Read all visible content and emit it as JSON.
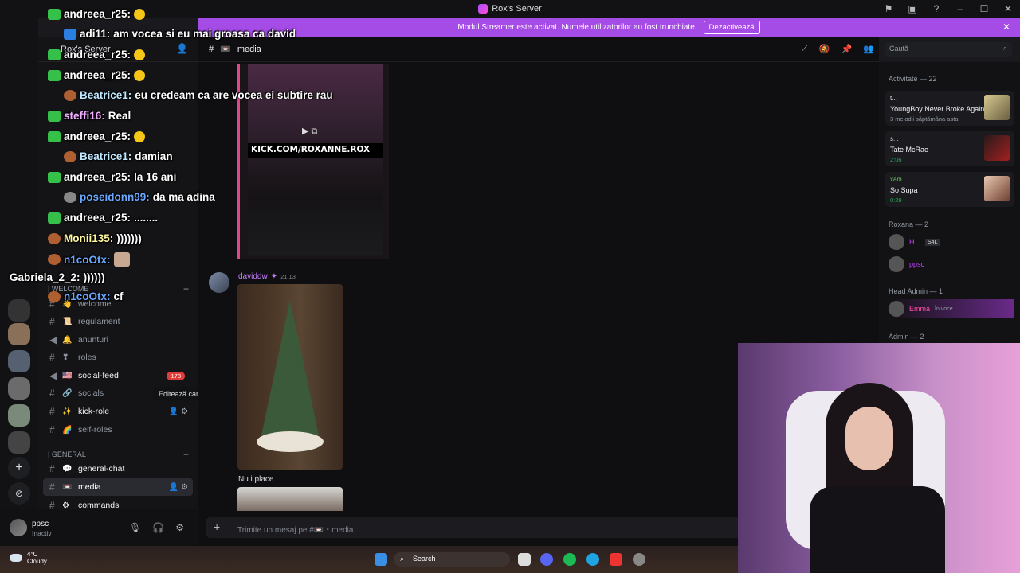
{
  "titlebar": {
    "title": "Rox's Server"
  },
  "banner": {
    "text": "Modul Streamer este activat. Numele utilizatorilor au fost trunchiate.",
    "button": "Dezactivează"
  },
  "server_header": {
    "name": "Rox's Server"
  },
  "channels": {
    "welcome_category": "| WELCOME",
    "general_category": "| GENERAL",
    "items": [
      {
        "label": "welcome",
        "emoji": "👋"
      },
      {
        "label": "regulament",
        "emoji": "📜"
      },
      {
        "label": "anunturi",
        "emoji": "🔔"
      },
      {
        "label": "roles",
        "emoji": "❣"
      },
      {
        "label": "social-feed",
        "emoji": "🇺🇸",
        "badge": "178"
      },
      {
        "label": "socials",
        "emoji": "🔗"
      },
      {
        "label": "kick-role",
        "emoji": "✨"
      },
      {
        "label": "self-roles",
        "emoji": "🌈"
      },
      {
        "label": "general-chat",
        "emoji": "💬"
      },
      {
        "label": "media",
        "emoji": "📼"
      },
      {
        "label": "commands",
        "emoji": "⚙"
      }
    ]
  },
  "tooltip": "Editează canalul",
  "user": {
    "name": "ppsc",
    "status": "Inactiv"
  },
  "main": {
    "channel": "media",
    "search_placeholder": "Caută",
    "kick_text": "KICK.COM/ROXANNE.ROX",
    "author": "daviddw",
    "time": "21:13",
    "message": "Nu i place",
    "composer_placeholder": "Trimite un mesaj pe #📼・media"
  },
  "members": {
    "activity_header": "Activitate — 22",
    "cards": [
      {
        "name": "t...",
        "title": "YoungBoy Never Broke Again",
        "sub": "3 melodii săptămâna asta"
      },
      {
        "name": "s...",
        "title": "Tate McRae",
        "sub": "2:06"
      },
      {
        "name": "xadi",
        "title": "So Supa",
        "sub": "0:29"
      }
    ],
    "roxana_header": "Roxana — 2",
    "head_admin_header": "Head Admin — 1",
    "admin_header": "Admin — 2",
    "rows": [
      {
        "name": "H...",
        "tag": "S4L"
      },
      {
        "name": "ppsc"
      },
      {
        "name": "Emma",
        "sub": "În voce"
      }
    ]
  },
  "overlay": [
    {
      "user": "andreea_r25:",
      "text": "",
      "color": "#ffffff"
    },
    {
      "user": "adi11:",
      "text": "am vocea si eu mai groasa ca david",
      "color": "#ffffff"
    },
    {
      "user": "andreea_r25:",
      "text": "",
      "color": "#ffffff"
    },
    {
      "user": "andreea_r25:",
      "text": "",
      "color": "#ffffff"
    },
    {
      "user": "Beatrice1:",
      "text": "eu credeam ca are vocea ei subtire rau",
      "color": "#c0e8ff"
    },
    {
      "user": "steffi16:",
      "text": "Real",
      "color": "#f0b0ff"
    },
    {
      "user": "andreea_r25:",
      "text": "",
      "color": "#ffffff"
    },
    {
      "user": "Beatrice1:",
      "text": "damian",
      "color": "#c0e8ff"
    },
    {
      "user": "andreea_r25:",
      "text": "la 16 ani",
      "color": "#ffffff"
    },
    {
      "user": "poseidonn99:",
      "text": "da ma adina",
      "color": "#6aa8ff"
    },
    {
      "user": "andreea_r25:",
      "text": "........",
      "color": "#ffffff"
    },
    {
      "user": "Monii135:",
      "text": ")))))))",
      "color": "#fff7a0"
    },
    {
      "user": "n1coOtx:",
      "text": "",
      "color": "#6aa8ff"
    },
    {
      "user": "Gabriela_2_2:",
      "text": "))))))",
      "color": "#ffffff"
    },
    {
      "user": "n1coOtx:",
      "text": "cf",
      "color": "#6aa8ff"
    }
  ],
  "taskbar": {
    "temp": "4°C",
    "weather": "Cloudy",
    "search": "Search"
  },
  "colors": {
    "banner": "#a54be6",
    "accent": "#c57cff",
    "badge": "#e03c3c"
  }
}
